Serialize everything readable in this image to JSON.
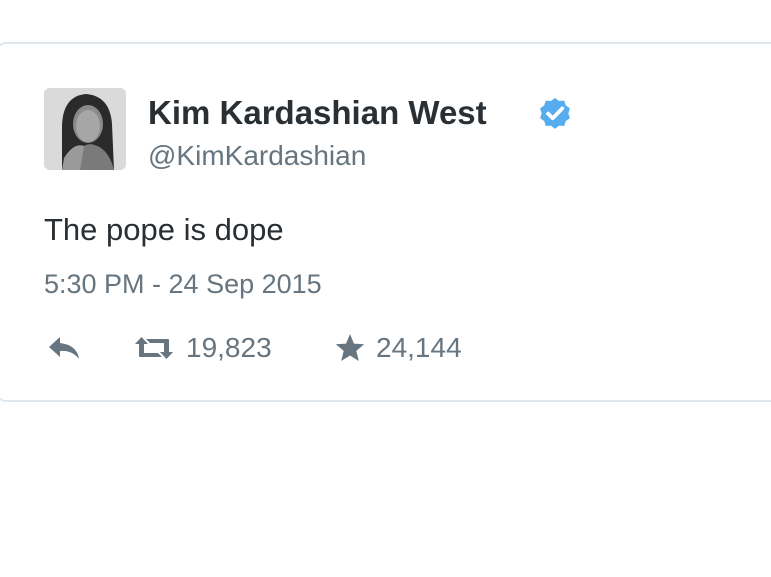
{
  "tweet": {
    "author": {
      "display_name": "Kim Kardashian West",
      "handle": "@KimKardashian",
      "verified": true
    },
    "text": "The pope is dope",
    "timestamp": "5:30 PM - 24 Sep 2015",
    "actions": {
      "reply_icon": "reply-icon",
      "retweet_icon": "retweet-icon",
      "retweet_count": "19,823",
      "favorite_icon": "star-icon",
      "favorite_count": "24,144"
    }
  },
  "colors": {
    "primary_text": "#292f33",
    "secondary_text": "#66757f",
    "verified_blue": "#55acee",
    "border": "#e1e8ed"
  }
}
